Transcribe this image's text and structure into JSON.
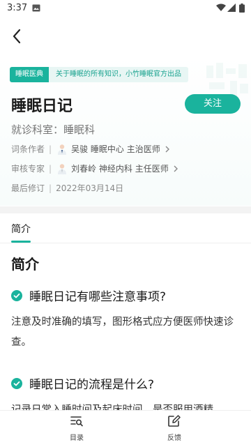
{
  "status_bar": {
    "time": "3:37"
  },
  "header": {
    "tag": "睡眠医典",
    "tag_desc": "关于睡眠的所有知识，小竹睡眠官方出品"
  },
  "entry": {
    "title": "睡眠日记",
    "follow_label": "关注",
    "department": "就诊科室：睡眠科",
    "author_label": "词条作者",
    "author": "吴骏 睡眠中心 主治医师",
    "reviewer_label": "审核专家",
    "reviewer": "刘春岭 神经内科 主任医师",
    "revised_label": "最后修订",
    "revised_date": "2022年03月14日"
  },
  "tabs": {
    "intro": "简介"
  },
  "content": {
    "section_title": "简介",
    "q1": "睡眠日记有哪些注意事项?",
    "a1": "注意及时准确的填写，图形格式应方便医师快速诊查。",
    "q2": "睡眠日记的流程是什么?",
    "a2": "记录日常入睡时间及起床时间，是否服用酒精"
  },
  "bottom_bar": {
    "catalog": "目录",
    "feedback": "反馈"
  },
  "colors": {
    "accent": "#1ab39d"
  }
}
